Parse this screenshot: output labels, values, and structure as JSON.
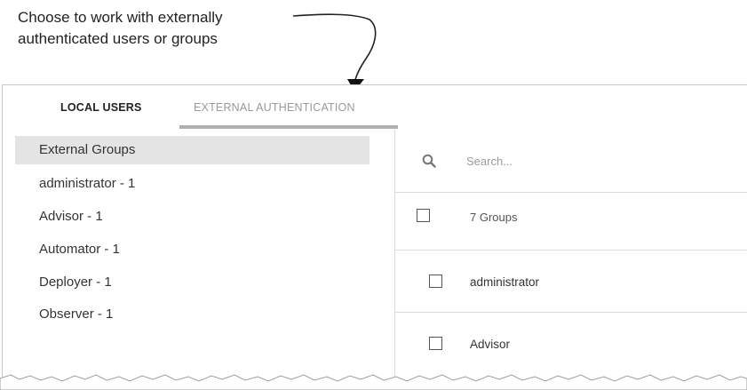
{
  "callout": {
    "line1": "Choose to work with externally",
    "line2": "authenticated users or groups"
  },
  "tabs": [
    {
      "label": "LOCAL USERS"
    },
    {
      "label": "EXTERNAL AUTHENTICATION",
      "active": true
    }
  ],
  "sidebar": {
    "items": [
      {
        "label": "External Groups",
        "selected": true
      },
      {
        "label": "administrator - 1"
      },
      {
        "label": "Advisor - 1"
      },
      {
        "label": "Automator - 1"
      },
      {
        "label": "Deployer - 1"
      },
      {
        "label": "Observer - 1"
      }
    ]
  },
  "main": {
    "search": {
      "placeholder": "Search...",
      "icon": "search-icon"
    },
    "header": {
      "label": "7 Groups"
    },
    "groups": [
      {
        "name": "administrator"
      },
      {
        "name": "Advisor"
      }
    ]
  },
  "colors": {
    "selected_bg": "#e4e4e4",
    "tab_underline": "#b0b0b0",
    "inactive_tab": "#9a9a9a"
  }
}
